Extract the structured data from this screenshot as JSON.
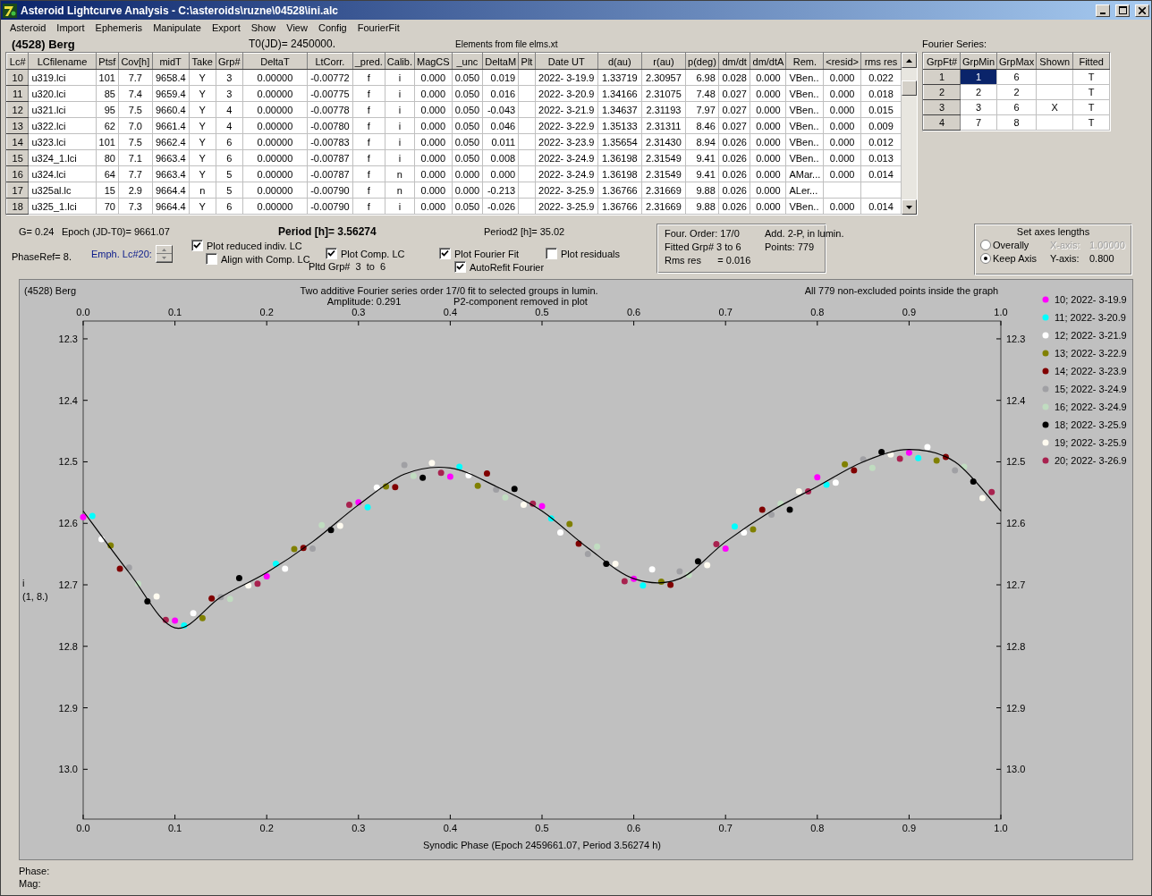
{
  "window": {
    "title": "Asteroid Lightcurve Analysis - C:\\asteroids\\ruzne\\04528\\ini.alc"
  },
  "menu": [
    "Asteroid",
    "Import",
    "Ephemeris",
    "Manipulate",
    "Export",
    "Show",
    "View",
    "Config",
    "FourierFit"
  ],
  "header": {
    "asteroid": "(4528) Berg",
    "t0": "T0(JD)= 2450000.",
    "elements": "Elements from file elms.xt"
  },
  "lc_table": {
    "columns": [
      "Lc#",
      "LCfilename",
      "Ptsf",
      "Cov[h]",
      "midT",
      "Take",
      "Grp#",
      "DeltaT",
      "LtCorr.",
      "_pred.",
      "Calib.",
      "MagCS",
      "_unc",
      "DeltaM",
      "Plt",
      "Date UT",
      "d(au)",
      "r(au)",
      "p(deg)",
      "dm/dt",
      "dm/dtA",
      "Rem.",
      "<resid>",
      "rms res"
    ],
    "rows": [
      [
        "10",
        "u319.lci",
        "101",
        "7.7",
        "9658.4",
        "Y",
        "3",
        "0.00000",
        "-0.00772",
        "f",
        "i",
        "0.000",
        "0.050",
        "0.019",
        "",
        "2022- 3-19.9",
        "1.33719",
        "2.30957",
        "6.98",
        "0.028",
        "0.000",
        "VBen..",
        "0.000",
        "0.022"
      ],
      [
        "11",
        "u320.lci",
        "85",
        "7.4",
        "9659.4",
        "Y",
        "3",
        "0.00000",
        "-0.00775",
        "f",
        "i",
        "0.000",
        "0.050",
        "0.016",
        "",
        "2022- 3-20.9",
        "1.34166",
        "2.31075",
        "7.48",
        "0.027",
        "0.000",
        "VBen..",
        "0.000",
        "0.018"
      ],
      [
        "12",
        "u321.lci",
        "95",
        "7.5",
        "9660.4",
        "Y",
        "4",
        "0.00000",
        "-0.00778",
        "f",
        "i",
        "0.000",
        "0.050",
        "-0.043",
        "",
        "2022- 3-21.9",
        "1.34637",
        "2.31193",
        "7.97",
        "0.027",
        "0.000",
        "VBen..",
        "0.000",
        "0.015"
      ],
      [
        "13",
        "u322.lci",
        "62",
        "7.0",
        "9661.4",
        "Y",
        "4",
        "0.00000",
        "-0.00780",
        "f",
        "i",
        "0.000",
        "0.050",
        "0.046",
        "",
        "2022- 3-22.9",
        "1.35133",
        "2.31311",
        "8.46",
        "0.027",
        "0.000",
        "VBen..",
        "0.000",
        "0.009"
      ],
      [
        "14",
        "u323.lci",
        "101",
        "7.5",
        "9662.4",
        "Y",
        "6",
        "0.00000",
        "-0.00783",
        "f",
        "i",
        "0.000",
        "0.050",
        "0.011",
        "",
        "2022- 3-23.9",
        "1.35654",
        "2.31430",
        "8.94",
        "0.026",
        "0.000",
        "VBen..",
        "0.000",
        "0.012"
      ],
      [
        "15",
        "u324_1.lci",
        "80",
        "7.1",
        "9663.4",
        "Y",
        "6",
        "0.00000",
        "-0.00787",
        "f",
        "i",
        "0.000",
        "0.050",
        "0.008",
        "",
        "2022- 3-24.9",
        "1.36198",
        "2.31549",
        "9.41",
        "0.026",
        "0.000",
        "VBen..",
        "0.000",
        "0.013"
      ],
      [
        "16",
        "u324.lci",
        "64",
        "7.7",
        "9663.4",
        "Y",
        "5",
        "0.00000",
        "-0.00787",
        "f",
        "n",
        "0.000",
        "0.000",
        "0.000",
        "",
        "2022- 3-24.9",
        "1.36198",
        "2.31549",
        "9.41",
        "0.026",
        "0.000",
        "AMar...",
        "0.000",
        "0.014"
      ],
      [
        "17",
        "u325al.lc",
        "15",
        "2.9",
        "9664.4",
        "n",
        "5",
        "0.00000",
        "-0.00790",
        "f",
        "n",
        "0.000",
        "0.000",
        "-0.213",
        "",
        "2022- 3-25.9",
        "1.36766",
        "2.31669",
        "9.88",
        "0.026",
        "0.000",
        "ALer...",
        "",
        ""
      ],
      [
        "18",
        "u325_1.lci",
        "70",
        "7.3",
        "9664.4",
        "Y",
        "6",
        "0.00000",
        "-0.00790",
        "f",
        "i",
        "0.000",
        "0.050",
        "-0.026",
        "",
        "2022- 3-25.9",
        "1.36766",
        "2.31669",
        "9.88",
        "0.026",
        "0.000",
        "VBen..",
        "0.000",
        "0.014"
      ]
    ]
  },
  "fourier": {
    "title": "Fourier Series:",
    "columns": [
      "GrpFt#",
      "GrpMin",
      "GrpMax",
      "Shown",
      "Fitted"
    ],
    "rows": [
      {
        "cells": [
          "1",
          "1",
          "6",
          "",
          "T"
        ],
        "selected": true
      },
      {
        "cells": [
          "2",
          "2",
          "2",
          "",
          "T"
        ],
        "selected": false
      },
      {
        "cells": [
          "3",
          "3",
          "6",
          "X",
          "T"
        ],
        "selected": false
      },
      {
        "cells": [
          "4",
          "7",
          "8",
          "",
          "T"
        ],
        "selected": false
      }
    ]
  },
  "params": {
    "g": "G= 0.24",
    "epoch": "Epoch (JD-T0)= 9661.07",
    "period": "Period [h]= 3.56274",
    "period2": "Period2 [h]= 35.02",
    "phase_ref": "PhaseRef= 8.",
    "emph": "Emph. Lc#20:",
    "pltd_grp": "Pltd Grp#  3  to  6"
  },
  "checkboxes": [
    {
      "label": "Plot reduced indiv. LC",
      "checked": true
    },
    {
      "label": "Align with Comp. LC",
      "checked": false
    },
    {
      "label": "Plot Comp. LC",
      "checked": true
    },
    {
      "label": "Plot Fourier Fit",
      "checked": true
    },
    {
      "label": "AutoRefit Fourier",
      "checked": true
    },
    {
      "label": "Plot residuals",
      "checked": false
    }
  ],
  "fit_info": [
    "Four. Order: 17/0",
    "Add. 2-P, in lumin.",
    "Fitted Grp# 3 to 6",
    "Points: 779",
    "Rms res      = 0.016"
  ],
  "axes": {
    "title": "Set axes lengths",
    "options": [
      {
        "label": "Overally",
        "selected": false
      },
      {
        "label": "Keep Axis",
        "selected": true
      }
    ],
    "x_axis": {
      "label": "X-axis:",
      "value": "1.00000",
      "disabled": true
    },
    "y_axis": {
      "label": "Y-axis:",
      "value": "0.800",
      "disabled": false
    }
  },
  "chart": {
    "object": "(4528) Berg",
    "title": "Two additive Fourier series order 17/0 fit to selected groups in lumin.",
    "amplitude": "Amplitude: 0.291",
    "p2_note": "P2-component removed in plot",
    "points_note": "All 779 non-excluded points inside the graph",
    "ylabel_extra": "(1, 8.)",
    "chart_data": {
      "type": "scatter",
      "legend": "right",
      "xlabel": "Synodic Phase (Epoch 2459661.07, Period 3.56274 h)",
      "ylabel": "i",
      "xlim": [
        0,
        1
      ],
      "ylim": [
        13.081,
        12.271
      ],
      "xticks": [
        {
          "value": 0,
          "label": "0.0"
        },
        {
          "value": 0.1,
          "label": "0.1"
        },
        {
          "value": 0.2,
          "label": "0.2"
        },
        {
          "value": 0.3,
          "label": "0.3"
        },
        {
          "value": 0.4,
          "label": "0.4"
        },
        {
          "value": 0.5,
          "label": "0.5"
        },
        {
          "value": 0.6,
          "label": "0.6"
        },
        {
          "value": 0.7,
          "label": "0.7"
        },
        {
          "value": 0.8,
          "label": "0.8"
        },
        {
          "value": 0.9,
          "label": "0.9"
        },
        {
          "value": 1,
          "label": "1.0"
        }
      ],
      "yticks": [
        {
          "value": 12.3,
          "label": "12.3"
        },
        {
          "value": 12.4,
          "label": "12.4"
        },
        {
          "value": 12.5,
          "label": "12.5"
        },
        {
          "value": 12.6,
          "label": "12.6"
        },
        {
          "value": 12.7,
          "label": "12.7"
        },
        {
          "value": 12.8,
          "label": "12.8"
        },
        {
          "value": 12.9,
          "label": "12.9"
        },
        {
          "value": 13.0,
          "label": "13.0"
        }
      ],
      "series": [
        {
          "name": "10; 2022- 3-19.9",
          "color": "#ff00ff",
          "x": [
            0,
            0.1,
            0.2,
            0.3,
            0.4,
            0.5,
            0.6,
            0.7,
            0.8,
            0.9
          ],
          "values": [
            12.59,
            12.758,
            12.686,
            12.566,
            12.524,
            12.572,
            12.69,
            12.641,
            12.525,
            12.485
          ]
        },
        {
          "name": "11; 2022- 3-20.9",
          "color": "#00ffff",
          "x": [
            0.01,
            0.11,
            0.21,
            0.31,
            0.41,
            0.51,
            0.61,
            0.71,
            0.81,
            0.91
          ],
          "values": [
            12.588,
            12.766,
            12.666,
            12.574,
            12.508,
            12.592,
            12.701,
            12.605,
            12.537,
            12.494
          ]
        },
        {
          "name": "12; 2022- 3-21.9",
          "color": "#ffffff",
          "x": [
            0.02,
            0.12,
            0.22,
            0.32,
            0.42,
            0.52,
            0.62,
            0.72,
            0.82,
            0.92
          ],
          "values": [
            12.626,
            12.746,
            12.674,
            12.542,
            12.522,
            12.615,
            12.675,
            12.615,
            12.534,
            12.476
          ]
        },
        {
          "name": "13; 2022- 3-22.9",
          "color": "#808000",
          "x": [
            0.03,
            0.13,
            0.23,
            0.33,
            0.43,
            0.53,
            0.63,
            0.73,
            0.83,
            0.93
          ],
          "values": [
            12.636,
            12.754,
            12.642,
            12.54,
            12.539,
            12.601,
            12.695,
            12.61,
            12.504,
            12.498
          ]
        },
        {
          "name": "14; 2022- 3-23.9",
          "color": "#800000",
          "x": [
            0.04,
            0.14,
            0.24,
            0.34,
            0.44,
            0.54,
            0.64,
            0.74,
            0.84,
            0.94
          ],
          "values": [
            12.674,
            12.722,
            12.64,
            12.541,
            12.519,
            12.633,
            12.7,
            12.578,
            12.514,
            12.492
          ]
        },
        {
          "name": "15; 2022- 3-24.9",
          "color": "#a0a0a4",
          "x": [
            0.05,
            0.15,
            0.25,
            0.35,
            0.45,
            0.55,
            0.65,
            0.75,
            0.85,
            0.95
          ],
          "values": [
            12.672,
            12.72,
            12.641,
            12.505,
            12.545,
            12.65,
            12.678,
            12.586,
            12.496,
            12.514
          ]
        },
        {
          "name": "16; 2022- 3-24.9",
          "color": "#c0dcc0",
          "x": [
            0.06,
            0.16,
            0.26,
            0.36,
            0.46,
            0.56,
            0.66,
            0.76,
            0.86,
            0.96
          ],
          "values": [
            12.698,
            12.723,
            12.603,
            12.523,
            12.558,
            12.638,
            12.684,
            12.568,
            12.51,
            12.508
          ]
        },
        {
          "name": "18; 2022- 3-25.9",
          "color": "#000000",
          "x": [
            0.07,
            0.17,
            0.27,
            0.37,
            0.47,
            0.57,
            0.67,
            0.77,
            0.87,
            0.97
          ],
          "values": [
            12.727,
            12.689,
            12.611,
            12.526,
            12.544,
            12.666,
            12.662,
            12.578,
            12.484,
            12.532
          ]
        },
        {
          "name": "19; 2022- 3-25.9",
          "color": "#fffbf0",
          "x": [
            0.08,
            0.18,
            0.28,
            0.38,
            0.48,
            0.58,
            0.68,
            0.78,
            0.88,
            0.98
          ],
          "values": [
            12.719,
            12.701,
            12.604,
            12.502,
            12.57,
            12.666,
            12.668,
            12.548,
            12.488,
            12.559
          ]
        },
        {
          "name": "20; 2022- 3-26.9",
          "color": "#a8224f",
          "x": [
            0.09,
            0.19,
            0.29,
            0.39,
            0.49,
            0.59,
            0.69,
            0.79,
            0.89,
            0.99
          ],
          "values": [
            12.757,
            12.698,
            12.57,
            12.518,
            12.568,
            12.694,
            12.634,
            12.548,
            12.495,
            12.549
          ]
        },
        {
          "color": "#000000",
          "type": "line",
          "x": [
            0,
            0.05,
            0.1,
            0.15,
            0.2,
            0.25,
            0.3,
            0.35,
            0.4,
            0.45,
            0.5,
            0.55,
            0.6,
            0.65,
            0.7,
            0.75,
            0.8,
            0.85,
            0.9,
            0.95,
            1
          ],
          "values": [
            12.58,
            12.68,
            12.77,
            12.72,
            12.68,
            12.63,
            12.57,
            12.52,
            12.51,
            12.54,
            12.58,
            12.64,
            12.69,
            12.69,
            12.63,
            12.58,
            12.54,
            12.5,
            12.48,
            12.5,
            12.58
          ]
        }
      ]
    }
  },
  "status": {
    "phase": "Phase:",
    "mag": "Mag:"
  }
}
